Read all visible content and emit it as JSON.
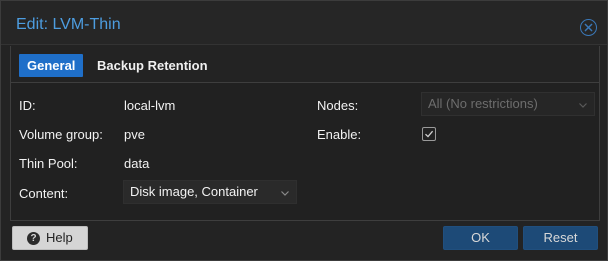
{
  "window": {
    "title": "Edit: LVM-Thin"
  },
  "tabs": [
    {
      "label": "General",
      "active": true
    },
    {
      "label": "Backup Retention",
      "active": false
    }
  ],
  "form": {
    "id": {
      "label": "ID:",
      "value": "local-lvm"
    },
    "volume_group": {
      "label": "Volume group:",
      "value": "pve"
    },
    "thin_pool": {
      "label": "Thin Pool:",
      "value": "data"
    },
    "content": {
      "label": "Content:",
      "value": "Disk image, Container"
    },
    "nodes": {
      "label": "Nodes:",
      "value": "All (No restrictions)",
      "disabled": true
    },
    "enable": {
      "label": "Enable:",
      "checked": true
    }
  },
  "footer": {
    "help_label": "Help",
    "ok_label": "OK",
    "reset_label": "Reset"
  },
  "colors": {
    "accent": "#1f6fc9",
    "title": "#4d9de0",
    "button_primary": "#1d4a77"
  },
  "icons": [
    "close-icon",
    "chevron-down-icon",
    "checkmark-icon",
    "help-icon"
  ]
}
